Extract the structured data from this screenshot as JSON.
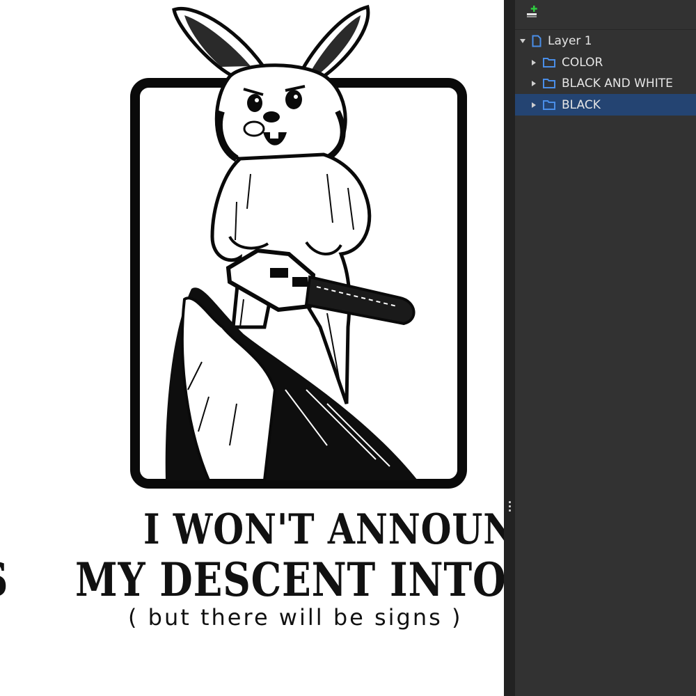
{
  "artwork": {
    "line1": "I WON'T ANNOUNCE",
    "line2": "MY DESCENT INTO MADNES",
    "line2_wrap": "S",
    "line3": "( but there will be signs )"
  },
  "layers_panel": {
    "toolbar": {
      "new_layer_icon": "add-layer-icon"
    },
    "items": [
      {
        "label": "Layer 1",
        "type": "layer",
        "icon": "document-icon",
        "expanded": true,
        "selected": false
      },
      {
        "label": "COLOR",
        "type": "folder",
        "icon": "folder-icon",
        "expanded": false,
        "selected": false
      },
      {
        "label": "BLACK AND WHITE",
        "type": "folder",
        "icon": "folder-icon",
        "expanded": false,
        "selected": false
      },
      {
        "label": "BLACK",
        "type": "folder",
        "icon": "folder-icon",
        "expanded": false,
        "selected": true
      }
    ]
  },
  "colors": {
    "panel_bg": "#323232",
    "selection": "#244472",
    "icon_accent": "#4a8ee8",
    "add_accent": "#2ecc40"
  }
}
